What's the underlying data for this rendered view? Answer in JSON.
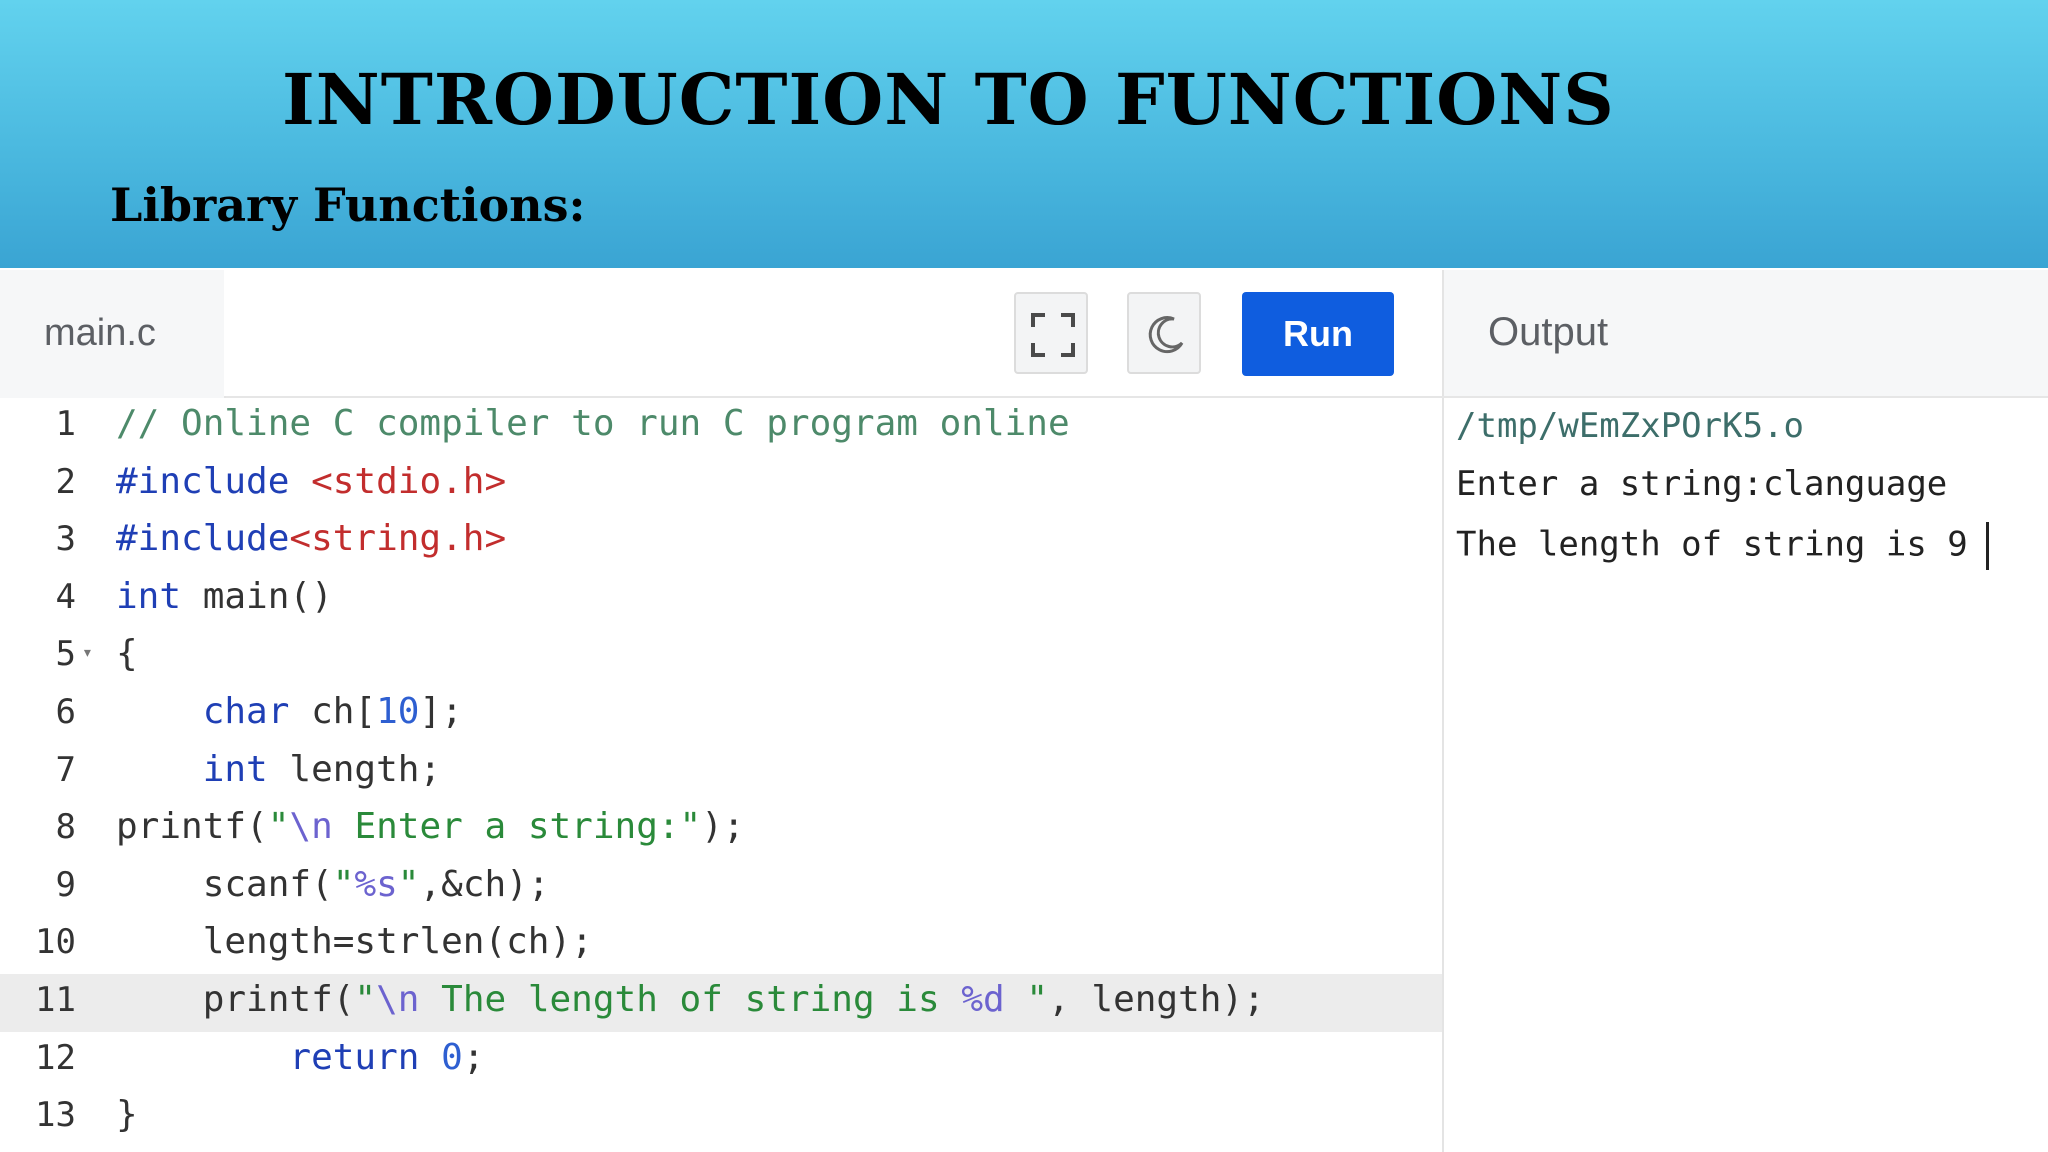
{
  "slide": {
    "title": "INTRODUCTION TO FUNCTIONS",
    "subtitle": "Library Functions:"
  },
  "editor": {
    "filename": "main.c",
    "run_label": "Run",
    "lines": [
      {
        "num": "1",
        "indent": "",
        "tokens": [
          {
            "t": "// Online C compiler to run C program online",
            "c": "comment"
          }
        ]
      },
      {
        "num": "2",
        "indent": "",
        "tokens": [
          {
            "t": "#include ",
            "c": "directive"
          },
          {
            "t": "<stdio.h>",
            "c": "header"
          }
        ]
      },
      {
        "num": "3",
        "indent": "",
        "tokens": [
          {
            "t": "#include",
            "c": "directive"
          },
          {
            "t": "<string.h>",
            "c": "header"
          }
        ]
      },
      {
        "num": "4",
        "indent": "",
        "tokens": [
          {
            "t": "int",
            "c": "kw"
          },
          {
            "t": " main()",
            "c": "plain"
          }
        ]
      },
      {
        "num": "5",
        "indent": "",
        "fold": true,
        "tokens": [
          {
            "t": "{",
            "c": "plain"
          }
        ]
      },
      {
        "num": "6",
        "indent": "  ",
        "tokens": [
          {
            "t": "char",
            "c": "kw"
          },
          {
            "t": " ch[",
            "c": "plain"
          },
          {
            "t": "10",
            "c": "num"
          },
          {
            "t": "];",
            "c": "plain"
          }
        ]
      },
      {
        "num": "7",
        "indent": "  ",
        "tokens": [
          {
            "t": "int",
            "c": "kw"
          },
          {
            "t": " length;",
            "c": "plain"
          }
        ]
      },
      {
        "num": "8",
        "indent": "",
        "tokens": [
          {
            "t": "printf(",
            "c": "plain"
          },
          {
            "t": "\"",
            "c": "str"
          },
          {
            "t": "\\n",
            "c": "esc"
          },
          {
            "t": " Enter a string:\"",
            "c": "str"
          },
          {
            "t": ");",
            "c": "plain"
          }
        ]
      },
      {
        "num": "9",
        "indent": "  ",
        "tokens": [
          {
            "t": "scanf(",
            "c": "plain"
          },
          {
            "t": "\"",
            "c": "str"
          },
          {
            "t": "%s",
            "c": "esc"
          },
          {
            "t": "\"",
            "c": "str"
          },
          {
            "t": ",&ch);",
            "c": "plain"
          }
        ]
      },
      {
        "num": "10",
        "indent": "  ",
        "tokens": [
          {
            "t": "length=strlen(ch);",
            "c": "plain"
          }
        ]
      },
      {
        "num": "11",
        "indent": "  ",
        "active": true,
        "tokens": [
          {
            "t": "printf(",
            "c": "plain"
          },
          {
            "t": "\"",
            "c": "str"
          },
          {
            "t": "\\n",
            "c": "esc"
          },
          {
            "t": " The length of string is ",
            "c": "str"
          },
          {
            "t": "%d",
            "c": "esc"
          },
          {
            "t": " \"",
            "c": "str"
          },
          {
            "t": ", length);",
            "c": "plain"
          }
        ]
      },
      {
        "num": "12",
        "indent": "    ",
        "tokens": [
          {
            "t": "return",
            "c": "kw"
          },
          {
            "t": " ",
            "c": "plain"
          },
          {
            "t": "0",
            "c": "num"
          },
          {
            "t": ";",
            "c": "plain"
          }
        ]
      },
      {
        "num": "13",
        "indent": "",
        "tokens": [
          {
            "t": "}",
            "c": "plain"
          }
        ]
      }
    ]
  },
  "output": {
    "label": "Output",
    "lines": [
      "/tmp/wEmZxPOrK5.o",
      "Enter a string:clanguage",
      "The length of string is 9"
    ]
  },
  "icons": {
    "fullscreen": "fullscreen-icon",
    "theme": "moon-icon"
  },
  "colors": {
    "banner": "#4cc0e3",
    "run_button": "#0f5ddf",
    "active_line": "#ececec"
  }
}
